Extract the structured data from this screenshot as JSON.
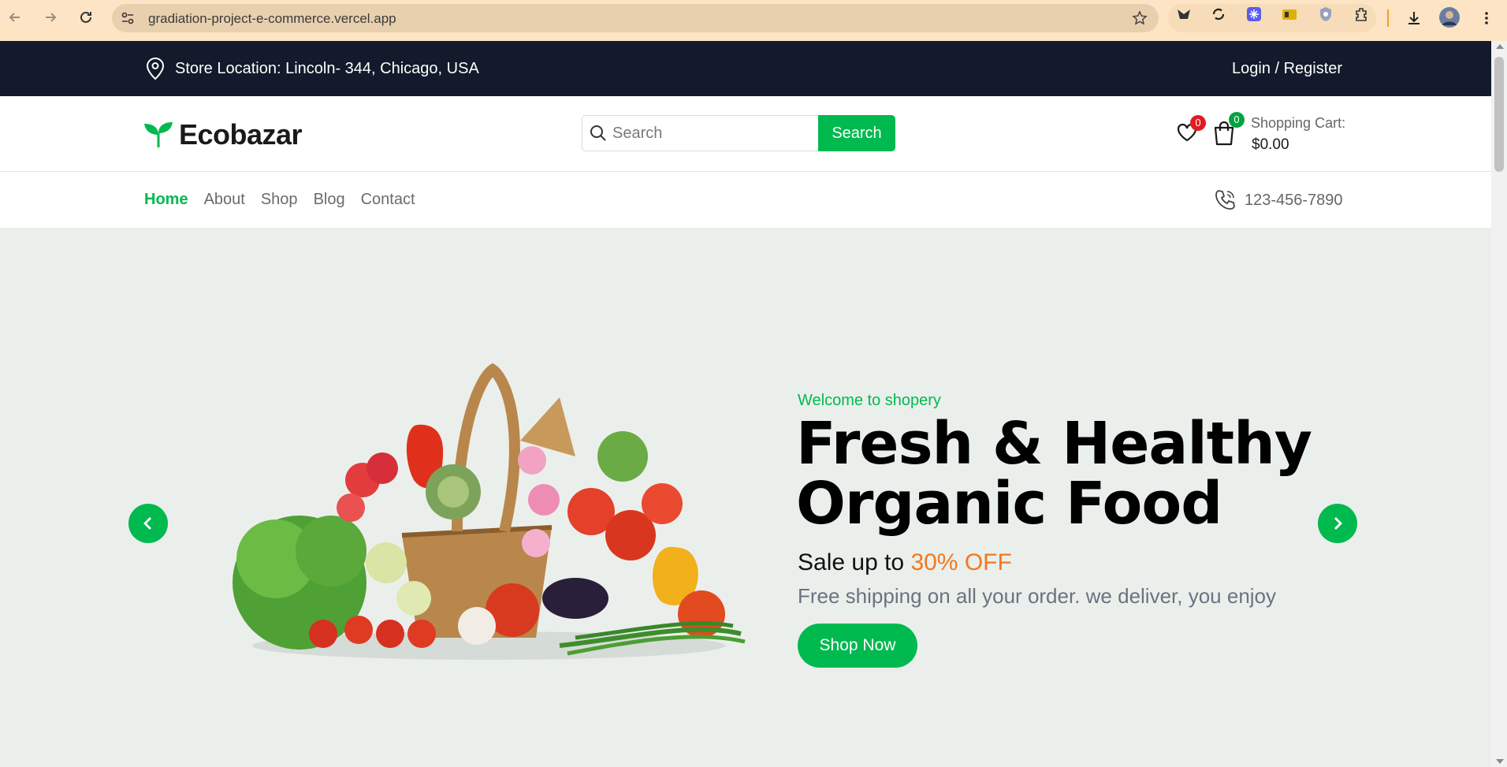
{
  "browser": {
    "url": "gradiation-project-e-commerce.vercel.app",
    "icons": [
      "back-icon",
      "forward-icon",
      "reload-icon",
      "site-settings-icon",
      "bookmark-star-icon",
      "extension-icons",
      "download-icon",
      "profile-avatar",
      "menu-dots-icon"
    ]
  },
  "topbar": {
    "location": "Store Location: Lincoln- 344, Chicago, USA",
    "login": "Login / Register"
  },
  "header": {
    "logo": "Ecobazar",
    "search_placeholder": "Search",
    "search_button": "Search",
    "wishlist_count": "0",
    "cart_count": "0",
    "cart_label": "Shopping Cart:",
    "cart_total": "$0.00"
  },
  "nav": {
    "items": [
      {
        "label": "Home",
        "active": true
      },
      {
        "label": "About",
        "active": false
      },
      {
        "label": "Shop",
        "active": false
      },
      {
        "label": "Blog",
        "active": false
      },
      {
        "label": "Contact",
        "active": false
      }
    ],
    "phone": "123-456-7890"
  },
  "hero": {
    "welcome": "Welcome to shopery",
    "headline_line1": "Fresh & Healthy",
    "headline_line2": "Organic Food",
    "sale_prefix": "Sale up to ",
    "sale_highlight": "30% OFF",
    "shipping": "Free shipping on all your order. we deliver, you enjoy",
    "button": "Shop Now"
  },
  "colors": {
    "primary_green": "#00b94f",
    "dark_bar": "#121a2b",
    "hero_bg": "#ebefec",
    "sale_orange": "#f27820",
    "chrome_bg": "#fce4c4"
  }
}
